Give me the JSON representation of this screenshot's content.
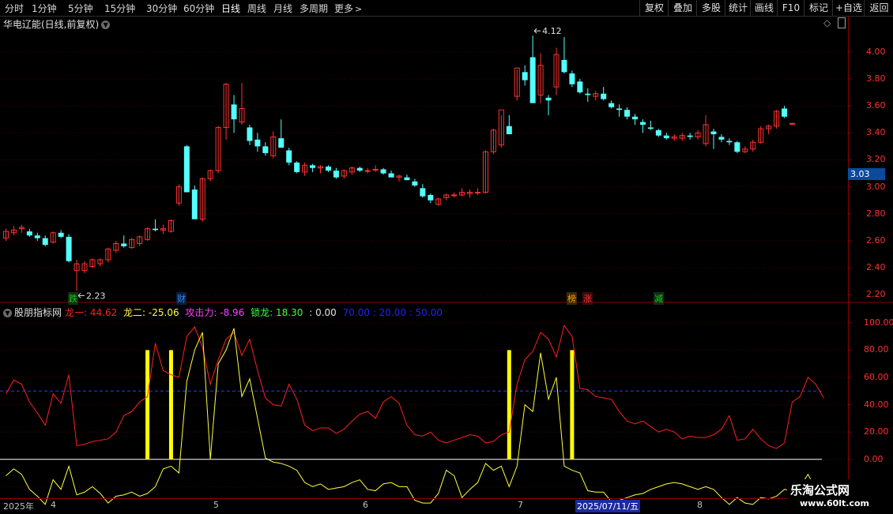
{
  "toolbar": {
    "periods": [
      "分时",
      "1分钟",
      "5分钟",
      "15分钟",
      "30分钟",
      "60分钟",
      "日线",
      "周线",
      "月线",
      "多周期",
      "更多"
    ],
    "active_period": "日线",
    "right_buttons": [
      "复权",
      "叠加",
      "多股",
      "统计",
      "画线",
      "F10",
      "标记",
      "+自选",
      "返回"
    ]
  },
  "main_panel": {
    "title": "华电辽能(日线,前复权)",
    "high_label": "4.12",
    "low_label": "2.23",
    "current_price": "3.03",
    "markers": [
      {
        "text": "跌",
        "color": "#1ec81e"
      },
      {
        "text": "财",
        "color": "#2e8bff"
      },
      {
        "text": "榜",
        "color": "#ff9900"
      },
      {
        "text": "涨",
        "color": "#ff3030"
      },
      {
        "text": "减",
        "color": "#1ec81e"
      }
    ]
  },
  "indicator": {
    "name": "股朋指标网",
    "values": [
      {
        "label": "龙一: 44.62",
        "color": "#ff2020"
      },
      {
        "label": "龙二: -25.06",
        "color": "#ffff40"
      },
      {
        "label": "攻击力: -8.96",
        "color": "#ff40ff"
      },
      {
        "label": "锁龙: 18.30",
        "color": "#40ff40"
      },
      {
        "label": ": 0.00",
        "color": "#e0e0e0"
      },
      {
        "label": "70.00 : 20.00 : 50.00",
        "color": "#2020ff"
      }
    ]
  },
  "date_axis": {
    "labels": [
      "2025年",
      "4",
      "5",
      "6",
      "7",
      "8"
    ],
    "highlight": "2025/07/11/五"
  },
  "watermark": {
    "name": "乐淘公式网",
    "url": "www.60lt.com"
  },
  "chart_data": [
    {
      "type": "candlestick",
      "title": "华电辽能(日线,前复权)",
      "ylim": [
        2.15,
        4.15
      ],
      "yticks": [
        4.0,
        3.8,
        3.6,
        3.4,
        3.2,
        3.0,
        2.8,
        2.6,
        2.4,
        2.2
      ],
      "annotations": [
        {
          "text": "4.12",
          "value": 4.12
        },
        {
          "text": "2.23",
          "value": 2.23
        }
      ],
      "current": 3.03,
      "candles": [
        [
          2.62,
          2.69,
          2.6,
          2.67
        ],
        [
          2.66,
          2.71,
          2.64,
          2.68
        ],
        [
          2.69,
          2.72,
          2.66,
          2.7
        ],
        [
          2.67,
          2.69,
          2.63,
          2.64
        ],
        [
          2.64,
          2.66,
          2.6,
          2.62
        ],
        [
          2.62,
          2.64,
          2.56,
          2.57
        ],
        [
          2.59,
          2.67,
          2.58,
          2.66
        ],
        [
          2.66,
          2.68,
          2.62,
          2.63
        ],
        [
          2.63,
          2.65,
          2.44,
          2.45
        ],
        [
          2.38,
          2.46,
          2.23,
          2.43
        ],
        [
          2.38,
          2.45,
          2.36,
          2.43
        ],
        [
          2.41,
          2.47,
          2.4,
          2.46
        ],
        [
          2.43,
          2.47,
          2.41,
          2.46
        ],
        [
          2.46,
          2.55,
          2.44,
          2.54
        ],
        [
          2.53,
          2.6,
          2.51,
          2.58
        ],
        [
          2.58,
          2.64,
          2.55,
          2.56
        ],
        [
          2.55,
          2.62,
          2.54,
          2.61
        ],
        [
          2.58,
          2.64,
          2.56,
          2.63
        ],
        [
          2.61,
          2.7,
          2.6,
          2.69
        ],
        [
          2.69,
          2.76,
          2.67,
          2.68
        ],
        [
          2.68,
          2.72,
          2.65,
          2.69
        ],
        [
          2.67,
          2.76,
          2.66,
          2.75
        ],
        [
          2.88,
          3.02,
          2.86,
          3.0
        ],
        [
          3.3,
          3.31,
          2.96,
          2.96
        ],
        [
          2.98,
          3.01,
          2.76,
          2.76
        ],
        [
          2.76,
          3.07,
          2.74,
          3.06
        ],
        [
          3.06,
          3.13,
          3.04,
          3.12
        ],
        [
          3.12,
          3.45,
          3.1,
          3.44
        ],
        [
          3.44,
          3.77,
          3.35,
          3.76
        ],
        [
          3.61,
          3.68,
          3.4,
          3.5
        ],
        [
          3.48,
          3.77,
          3.46,
          3.58
        ],
        [
          3.44,
          3.46,
          3.31,
          3.34
        ],
        [
          3.35,
          3.4,
          3.26,
          3.3
        ],
        [
          3.3,
          3.33,
          3.23,
          3.25
        ],
        [
          3.23,
          3.41,
          3.21,
          3.37
        ],
        [
          3.36,
          3.5,
          3.32,
          3.29
        ],
        [
          3.27,
          3.29,
          3.16,
          3.18
        ],
        [
          3.18,
          3.19,
          3.1,
          3.11
        ],
        [
          3.11,
          3.18,
          3.08,
          3.16
        ],
        [
          3.16,
          3.17,
          3.11,
          3.14
        ],
        [
          3.14,
          3.16,
          3.1,
          3.15
        ],
        [
          3.15,
          3.16,
          3.11,
          3.12
        ],
        [
          3.12,
          3.14,
          3.06,
          3.07
        ],
        [
          3.08,
          3.13,
          3.06,
          3.12
        ],
        [
          3.11,
          3.15,
          3.09,
          3.14
        ],
        [
          3.14,
          3.15,
          3.11,
          3.12
        ],
        [
          3.12,
          3.14,
          3.1,
          3.12
        ],
        [
          3.13,
          3.16,
          3.11,
          3.13
        ],
        [
          3.13,
          3.14,
          3.09,
          3.1
        ],
        [
          3.1,
          3.12,
          3.07,
          3.07
        ],
        [
          3.07,
          3.09,
          3.04,
          3.08
        ],
        [
          3.07,
          3.09,
          3.05,
          3.05
        ],
        [
          3.04,
          3.06,
          3.0,
          3.01
        ],
        [
          2.99,
          3.02,
          2.92,
          2.93
        ],
        [
          2.94,
          2.95,
          2.88,
          2.9
        ],
        [
          2.87,
          2.92,
          2.86,
          2.91
        ],
        [
          2.92,
          2.95,
          2.9,
          2.94
        ],
        [
          2.94,
          2.96,
          2.92,
          2.94
        ],
        [
          2.94,
          2.99,
          2.93,
          2.96
        ],
        [
          2.95,
          2.98,
          2.92,
          2.96
        ],
        [
          2.96,
          2.99,
          2.94,
          2.96
        ],
        [
          2.96,
          3.27,
          2.95,
          3.26
        ],
        [
          3.26,
          3.43,
          3.24,
          3.42
        ],
        [
          3.31,
          3.53,
          3.29,
          3.57
        ],
        [
          3.45,
          3.53,
          3.4,
          3.39
        ],
        [
          3.67,
          3.87,
          3.64,
          3.88
        ],
        [
          3.85,
          3.9,
          3.75,
          3.79
        ],
        [
          3.96,
          4.12,
          3.69,
          3.62
        ],
        [
          3.68,
          3.99,
          3.62,
          3.9
        ],
        [
          3.66,
          3.68,
          3.53,
          3.64
        ],
        [
          3.74,
          4.03,
          3.68,
          3.98
        ],
        [
          3.94,
          4.11,
          3.84,
          3.85
        ],
        [
          3.84,
          3.86,
          3.74,
          3.76
        ],
        [
          3.78,
          3.8,
          3.69,
          3.7
        ],
        [
          3.69,
          3.73,
          3.63,
          3.68
        ],
        [
          3.67,
          3.71,
          3.64,
          3.69
        ],
        [
          3.69,
          3.74,
          3.64,
          3.65
        ],
        [
          3.62,
          3.64,
          3.58,
          3.59
        ],
        [
          3.58,
          3.61,
          3.52,
          3.57
        ],
        [
          3.57,
          3.59,
          3.5,
          3.52
        ],
        [
          3.52,
          3.54,
          3.46,
          3.5
        ],
        [
          3.48,
          3.5,
          3.4,
          3.46
        ],
        [
          3.44,
          3.49,
          3.42,
          3.43
        ],
        [
          3.42,
          3.43,
          3.37,
          3.38
        ],
        [
          3.38,
          3.4,
          3.35,
          3.36
        ],
        [
          3.36,
          3.39,
          3.34,
          3.37
        ],
        [
          3.36,
          3.4,
          3.34,
          3.38
        ],
        [
          3.38,
          3.4,
          3.35,
          3.37
        ],
        [
          3.37,
          3.42,
          3.35,
          3.4
        ],
        [
          3.32,
          3.53,
          3.3,
          3.46
        ],
        [
          3.41,
          3.43,
          3.28,
          3.39
        ],
        [
          3.37,
          3.39,
          3.33,
          3.35
        ],
        [
          3.34,
          3.36,
          3.31,
          3.33
        ],
        [
          3.33,
          3.34,
          3.25,
          3.26
        ],
        [
          3.26,
          3.3,
          3.25,
          3.28
        ],
        [
          3.28,
          3.35,
          3.26,
          3.33
        ],
        [
          3.33,
          3.45,
          3.32,
          3.43
        ],
        [
          3.43,
          3.46,
          3.39,
          3.45
        ],
        [
          3.45,
          3.57,
          3.43,
          3.56
        ],
        [
          3.58,
          3.6,
          3.51,
          3.52
        ],
        [
          3.47,
          3.47,
          3.46,
          3.47
        ]
      ]
    },
    {
      "type": "line",
      "title": "股朋指标网",
      "ylim": [
        -25,
        108
      ],
      "yticks": [
        100.0,
        80.0,
        60.0,
        40.0,
        20.0,
        0.0,
        -20.0
      ],
      "baseline": 0,
      "reference_line": 50,
      "series": [
        {
          "name": "龙一",
          "color": "#ff2020",
          "values": [
            48,
            58,
            55,
            42,
            34,
            25,
            48,
            41,
            62,
            10,
            11,
            13,
            14,
            15,
            20,
            32,
            35,
            42,
            46,
            85,
            65,
            62,
            60,
            90,
            97,
            82,
            55,
            73,
            88,
            93,
            76,
            88,
            65,
            45,
            40,
            39,
            55,
            44,
            25,
            21,
            23,
            23,
            19,
            22,
            28,
            33,
            35,
            30,
            42,
            46,
            41,
            25,
            18,
            17,
            20,
            14,
            12,
            14,
            16,
            18,
            17,
            12,
            13,
            18,
            20,
            55,
            73,
            79,
            93,
            88,
            75,
            98,
            90,
            52,
            51,
            46,
            45,
            44,
            35,
            28,
            26,
            28,
            24,
            20,
            22,
            20,
            15,
            17,
            16,
            16,
            18,
            22,
            32,
            14,
            15,
            22,
            15,
            10,
            8,
            12,
            42,
            46,
            60,
            55,
            45
          ]
        },
        {
          "name": "龙二",
          "color": "#ffff40",
          "values": [
            -12,
            -7,
            -11,
            -22,
            -27,
            -33,
            -15,
            -22,
            -5,
            -26,
            -24,
            -20,
            -25,
            -32,
            -27,
            -26,
            -24,
            -27,
            -25,
            -20,
            -7,
            -5,
            -10,
            57,
            80,
            93,
            0,
            70,
            80,
            96,
            46,
            59,
            30,
            1,
            -2,
            -3,
            -5,
            -8,
            -17,
            -20,
            -18,
            -22,
            -21,
            -20,
            -17,
            -15,
            -22,
            -23,
            -18,
            -17,
            -20,
            -20,
            -30,
            -32,
            -32,
            -25,
            -8,
            -12,
            -28,
            -22,
            -17,
            -3,
            -8,
            -5,
            -20,
            -5,
            40,
            35,
            78,
            44,
            60,
            -5,
            -8,
            -10,
            -23,
            -24,
            -24,
            -31,
            -30,
            -28,
            -26,
            -25,
            -22,
            -20,
            -18,
            -17,
            -18,
            -20,
            -22,
            -20,
            -22,
            -28,
            -33,
            -28,
            -32,
            -33,
            -28,
            -29,
            -27,
            -22,
            -23,
            -20,
            -11,
            -22,
            -25
          ]
        }
      ],
      "signal_bars_at_index": [
        18,
        21,
        64,
        72
      ]
    }
  ]
}
